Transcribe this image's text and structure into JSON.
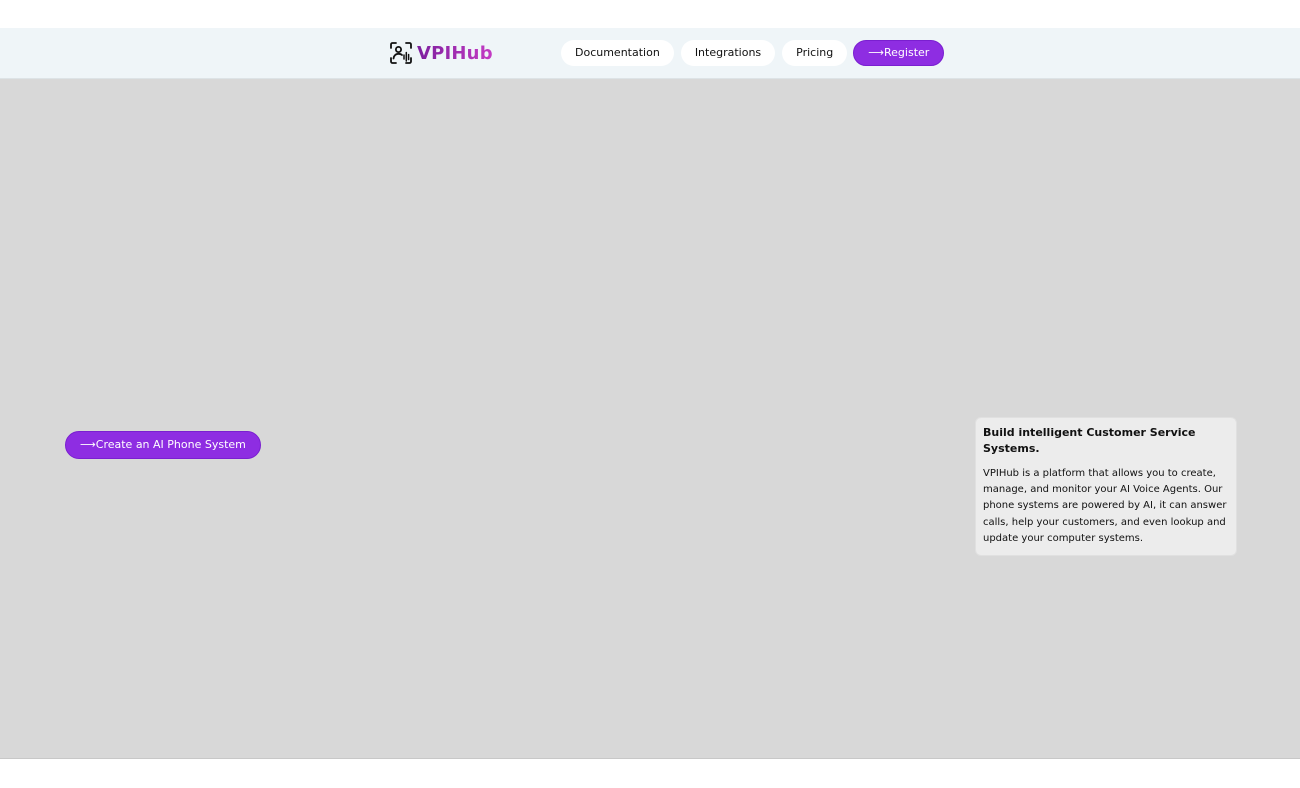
{
  "brand": {
    "name": "VPIHub",
    "icon": "face-scan-voice-icon",
    "gradient_start": "#7d1f9e",
    "gradient_end": "#c43bc4"
  },
  "nav": {
    "items": [
      {
        "label": "Documentation"
      },
      {
        "label": "Integrations"
      },
      {
        "label": "Pricing"
      }
    ],
    "register_label": "⟶Register"
  },
  "hero": {
    "cta_label": "⟶Create an AI Phone System",
    "card": {
      "title": "Build intelligent Customer Service Systems.",
      "body": "VPIHub is a platform that allows you to create, manage, and monitor your AI Voice Agents. Our phone systems are powered by AI, it can answer calls, help your customers, and even lookup and update your computer systems."
    }
  },
  "colors": {
    "accent": "#8e2de2",
    "navbar_bg": "#eff5f8",
    "hero_bg": "#d8d8d8",
    "card_bg": "#ececec"
  }
}
